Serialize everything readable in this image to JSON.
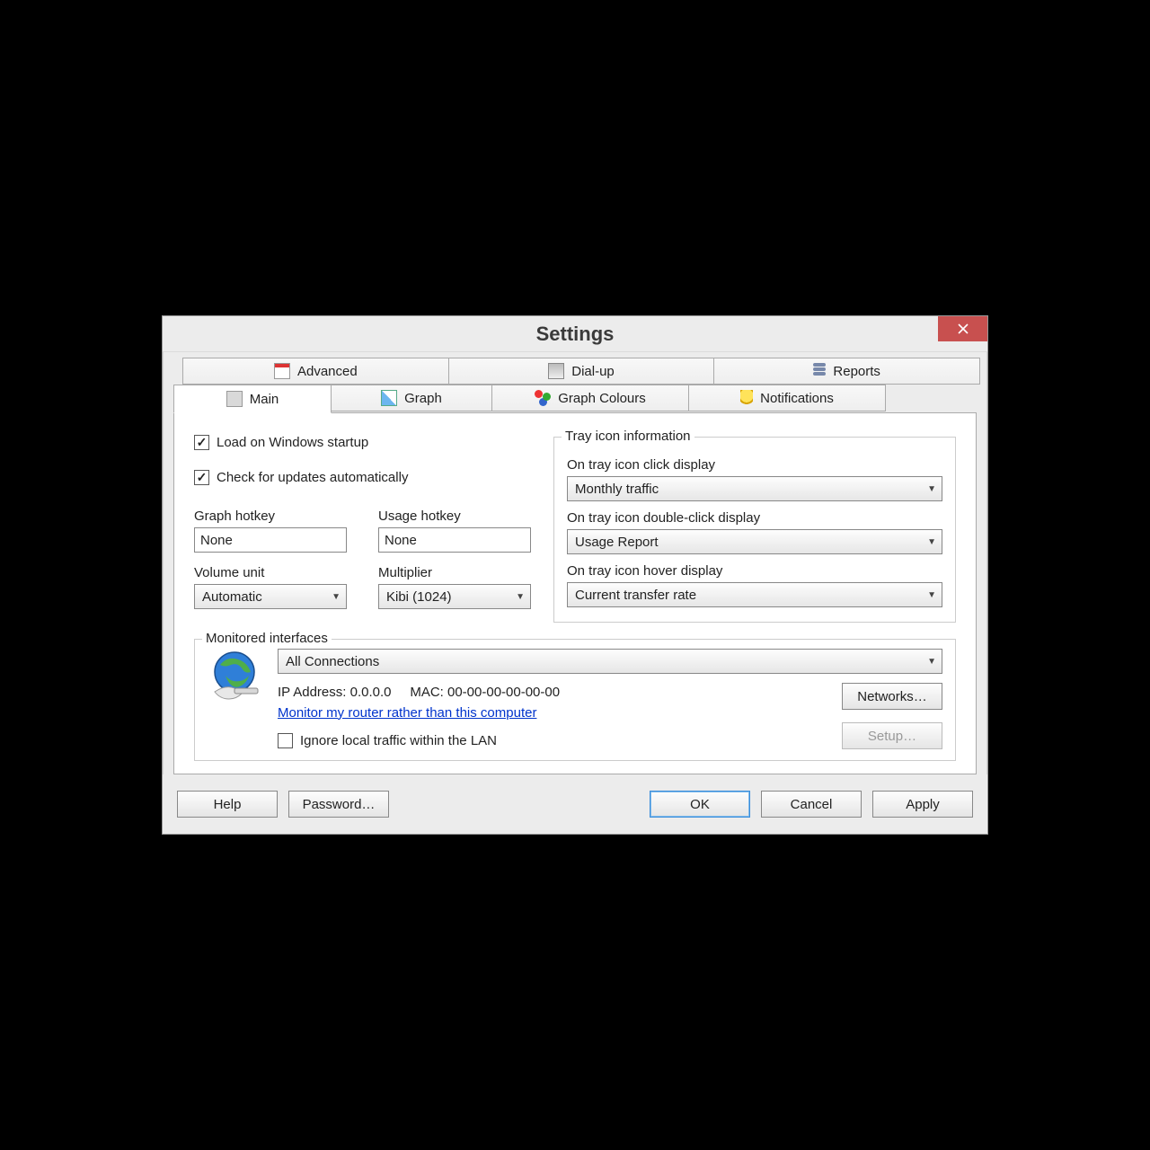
{
  "title": "Settings",
  "tabsTop": {
    "advanced": "Advanced",
    "dialup": "Dial-up",
    "reports": "Reports"
  },
  "tabsBottom": {
    "main": "Main",
    "graph": "Graph",
    "graphColours": "Graph Colours",
    "notifications": "Notifications"
  },
  "main": {
    "loadStartup": "Load on Windows startup",
    "checkUpdates": "Check for updates automatically",
    "graphHotkeyLabel": "Graph hotkey",
    "graphHotkeyValue": "None",
    "usageHotkeyLabel": "Usage hotkey",
    "usageHotkeyValue": "None",
    "volumeUnitLabel": "Volume unit",
    "volumeUnitValue": "Automatic",
    "multiplierLabel": "Multiplier",
    "multiplierValue": "Kibi (1024)"
  },
  "tray": {
    "legend": "Tray icon information",
    "clickLabel": "On tray icon click display",
    "clickValue": "Monthly traffic",
    "dblLabel": "On tray icon double-click display",
    "dblValue": "Usage Report",
    "hoverLabel": "On tray icon hover display",
    "hoverValue": "Current transfer rate"
  },
  "monitored": {
    "legend": "Monitored interfaces",
    "connection": "All Connections",
    "ipLabel": "IP Address: ",
    "ipValue": "0.0.0.0",
    "macLabel": "MAC: ",
    "macValue": "00-00-00-00-00-00",
    "link": "Monitor my router rather than this computer",
    "ignore": "Ignore local traffic within the LAN",
    "networksBtn": "Networks…",
    "setupBtn": "Setup…"
  },
  "footer": {
    "help": "Help",
    "password": "Password…",
    "ok": "OK",
    "cancel": "Cancel",
    "apply": "Apply"
  }
}
